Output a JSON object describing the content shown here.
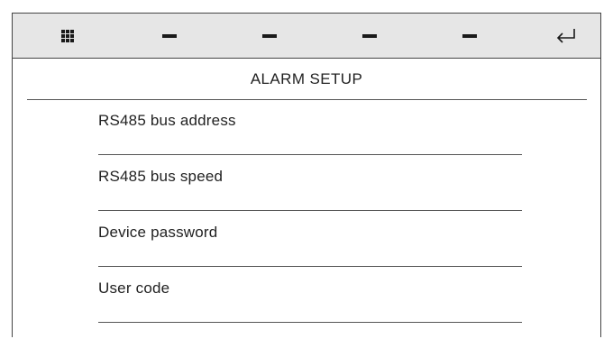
{
  "toolbar": {
    "icons": [
      "grid-menu-icon",
      "dash-icon",
      "dash-icon",
      "dash-icon",
      "dash-icon",
      "return-arrow-icon"
    ]
  },
  "screen": {
    "title": "ALARM SETUP"
  },
  "menu": {
    "items": [
      {
        "label": "RS485 bus address"
      },
      {
        "label": "RS485 bus speed"
      },
      {
        "label": "Device password"
      },
      {
        "label": "User code"
      }
    ]
  },
  "colors": {
    "toolbar_bg": "#e6e6e6",
    "icon": "#1a1a1a",
    "text": "#222222",
    "rule": "#555555"
  }
}
